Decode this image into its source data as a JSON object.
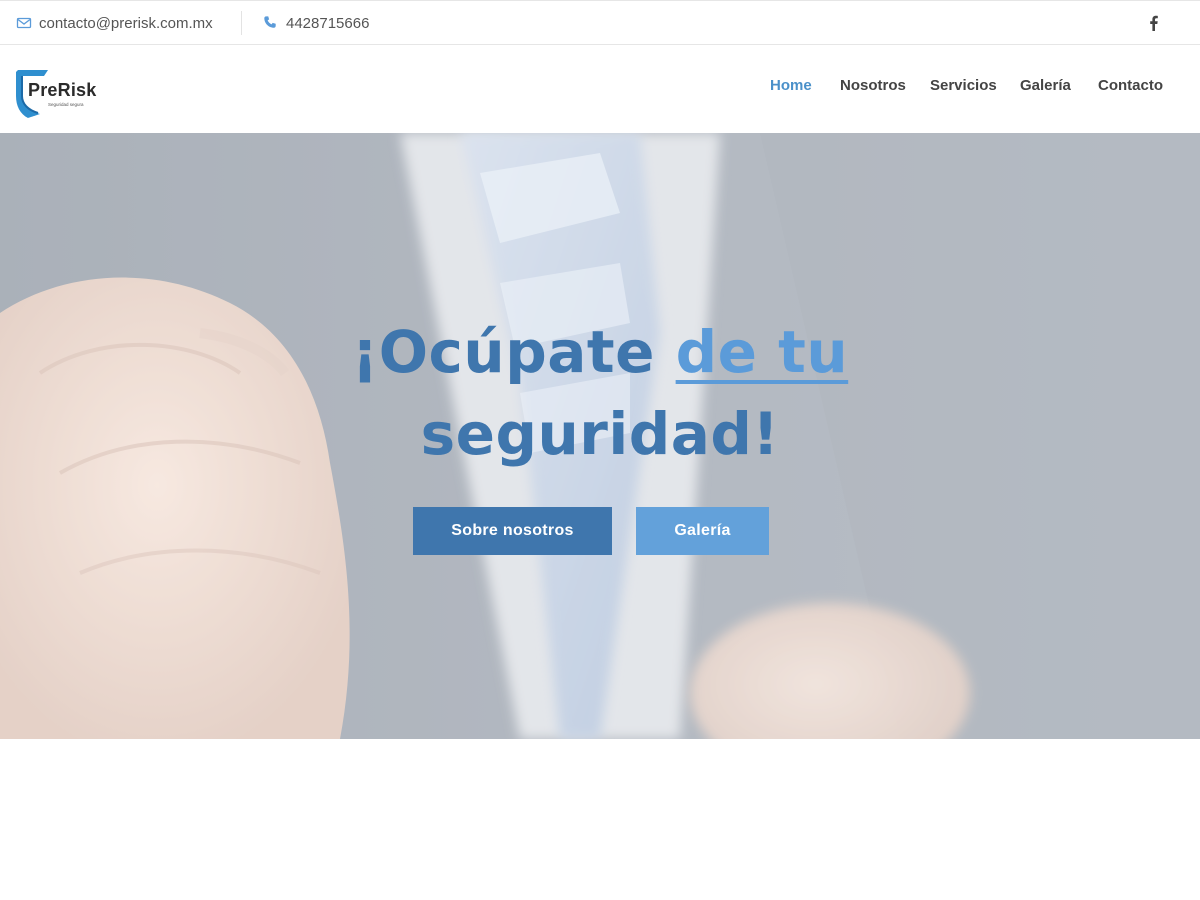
{
  "topbar": {
    "email": "contacto@prerisk.com.mx",
    "phone": "4428715666",
    "icons": {
      "email": "envelope-icon",
      "phone": "phone-icon",
      "social": "facebook-icon"
    }
  },
  "header": {
    "logo": {
      "title": "PreRisk",
      "subtitle": "Seguridad segura"
    },
    "nav": [
      {
        "label": "Home",
        "active": true
      },
      {
        "label": "Nosotros",
        "active": false
      },
      {
        "label": "Servicios",
        "active": false
      },
      {
        "label": "Galería",
        "active": false
      },
      {
        "label": "Contacto",
        "active": false
      }
    ]
  },
  "hero": {
    "title_part1": "¡Ocúpate ",
    "title_highlight": "de tu",
    "title_part2": "seguridad!",
    "buttons": {
      "primary": "Sobre nosotros",
      "secondary": "Galería"
    }
  },
  "colors": {
    "accent": "#4a90c9",
    "hero_text": "#3f76ad",
    "hero_highlight": "#5b9bd9",
    "btn_primary": "#3f76ad",
    "btn_secondary": "#63a1da"
  }
}
